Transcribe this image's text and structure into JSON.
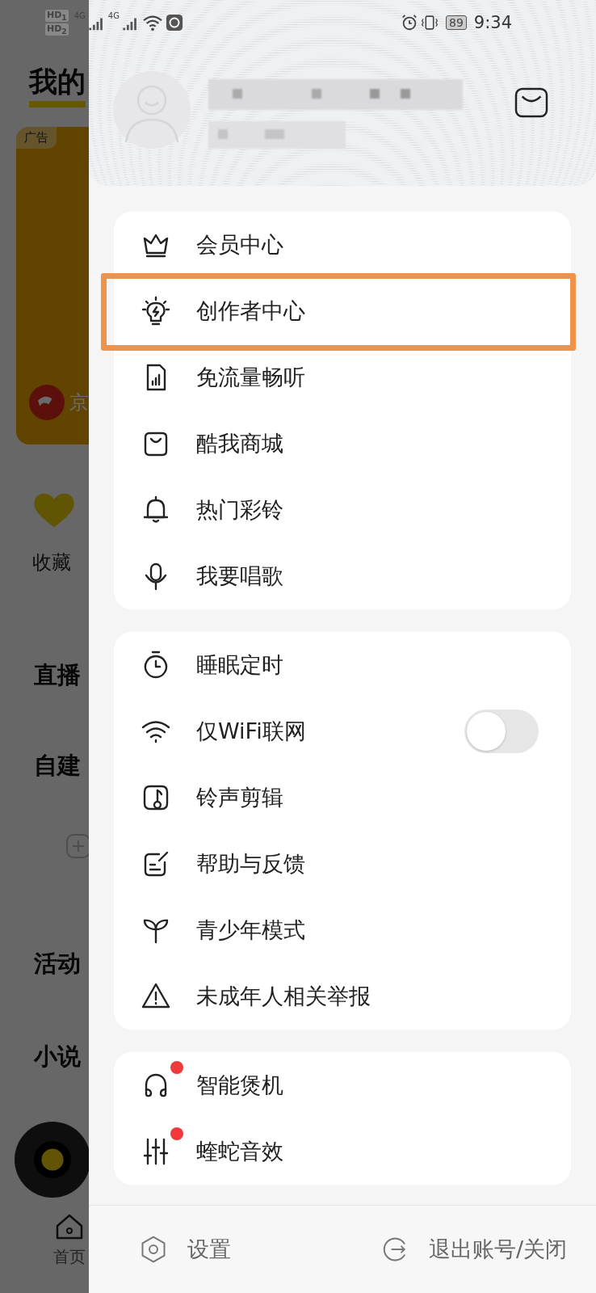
{
  "status_bar": {
    "sim_badges": [
      "HD$_{1}$",
      "HD$_{2}$"
    ],
    "networks": [
      "4G",
      "4G"
    ],
    "battery": "89",
    "time": "9:34"
  },
  "background_app": {
    "title": "我的",
    "ad_badge": "广告",
    "ad_caption": "京",
    "favorites": "收藏",
    "sections": [
      "直播",
      "自建",
      "活动",
      "小说"
    ],
    "home_tab": "首页"
  },
  "drawer": {
    "menu_groups": [
      {
        "items": [
          {
            "kind": "link",
            "label": "会员中心",
            "badge": false,
            "highlighted": false
          },
          {
            "kind": "link",
            "label": "创作者中心",
            "badge": false,
            "highlighted": true
          },
          {
            "kind": "link",
            "label": "免流量畅听",
            "badge": false,
            "highlighted": false
          },
          {
            "kind": "link",
            "label": "酷我商城",
            "badge": false,
            "highlighted": false
          },
          {
            "kind": "link",
            "label": "热门彩铃",
            "badge": false,
            "highlighted": false
          },
          {
            "kind": "link",
            "label": "我要唱歌",
            "badge": false,
            "highlighted": false
          }
        ]
      },
      {
        "items": [
          {
            "kind": "link",
            "label": "睡眠定时",
            "badge": false,
            "highlighted": false
          },
          {
            "kind": "toggle",
            "label": "仅WiFi联网",
            "on": false,
            "badge": false,
            "highlighted": false
          },
          {
            "kind": "link",
            "label": "铃声剪辑",
            "badge": false,
            "highlighted": false
          },
          {
            "kind": "link",
            "label": "帮助与反馈",
            "badge": false,
            "highlighted": false
          },
          {
            "kind": "link",
            "label": "青少年模式",
            "badge": false,
            "highlighted": false
          },
          {
            "kind": "link",
            "label": "未成年人相关举报",
            "badge": false,
            "highlighted": false
          }
        ]
      },
      {
        "items": [
          {
            "kind": "link",
            "label": "智能煲机",
            "badge": true,
            "highlighted": false
          },
          {
            "kind": "link",
            "label": "蝰蛇音效",
            "badge": true,
            "highlighted": false
          }
        ]
      }
    ],
    "footer": {
      "settings": "设置",
      "logout": "退出账号/关闭"
    }
  }
}
